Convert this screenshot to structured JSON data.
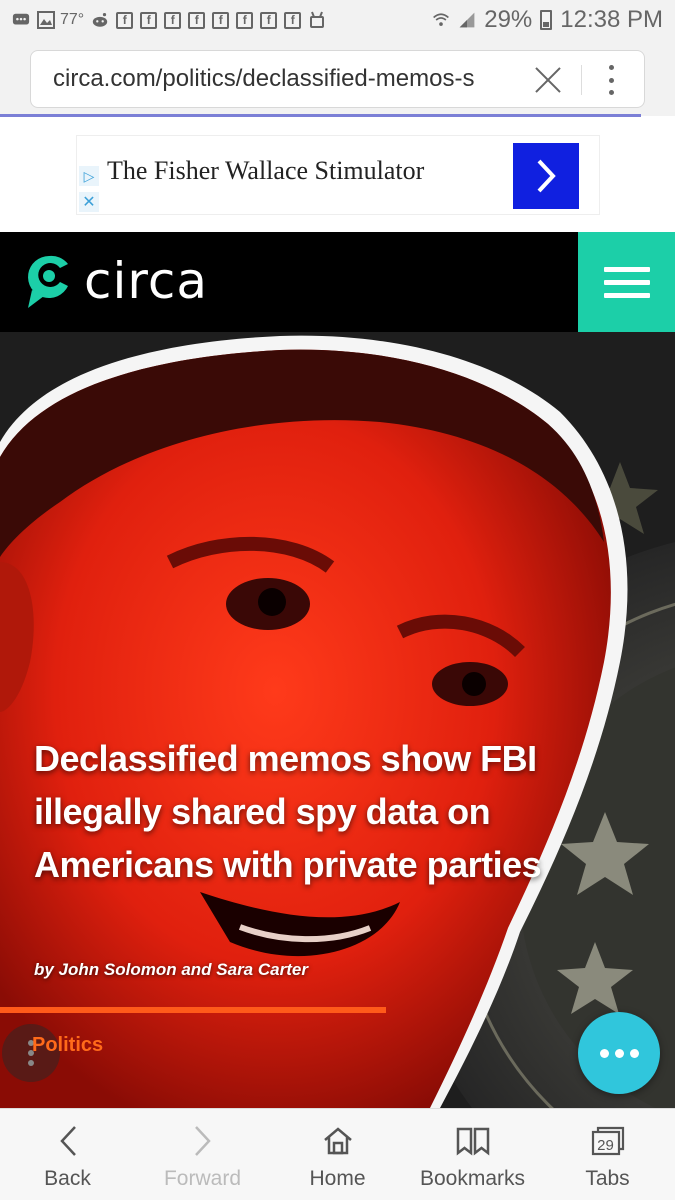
{
  "status_bar": {
    "temperature": "77°",
    "battery_percent": "29%",
    "time": "12:38 PM",
    "notification_icons": [
      "message-icon",
      "gallery-icon",
      "weather-icon",
      "reddit-icon",
      "facebook-icon",
      "facebook-icon",
      "facebook-icon",
      "facebook-icon",
      "facebook-icon",
      "facebook-icon",
      "facebook-icon",
      "facebook-icon",
      "android-icon"
    ],
    "facebook_glyph": "f"
  },
  "browser": {
    "url": "circa.com/politics/declassified-memos-s",
    "page_load_progress": 0.95
  },
  "ad": {
    "text": "The Fisher Wallace Stimulator",
    "choices_glyph": "▷",
    "close_glyph": "✕"
  },
  "site": {
    "logo_text": "circa",
    "accent_color": "#1ccfa8"
  },
  "article": {
    "headline": "Declassified memos show FBI illegally shared spy data on Americans with private parties",
    "byline": "by John Solomon and Sara Carter",
    "category": "Politics",
    "category_color": "#ff6a1a"
  },
  "bottom_nav": {
    "back": "Back",
    "forward": "Forward",
    "home": "Home",
    "bookmarks": "Bookmarks",
    "tabs": "Tabs",
    "tab_count": "29"
  }
}
